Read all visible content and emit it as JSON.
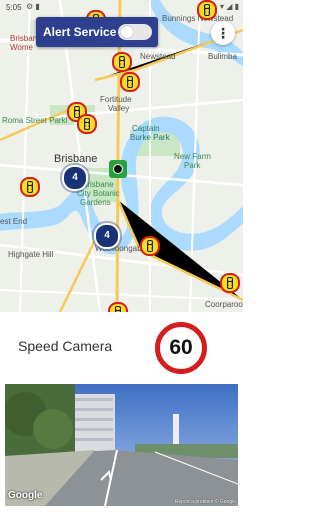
{
  "status_bar": {
    "time": "5:05",
    "left_icons": "⚙ ▮",
    "right_icons": "▾ ◢ ▮"
  },
  "alert_service": {
    "label": "Alert Service",
    "enabled": false
  },
  "menu_icon": "more-vert-icon",
  "map": {
    "labels": {
      "bunnings": "Bunnings Newstead",
      "newstead": "Newstead",
      "bulimba": "Bulimba",
      "fortitude": "Fortitude",
      "valley": "Valley",
      "roma": "Roma Street Parkl",
      "captain": "Captain",
      "burke": "Burke Park",
      "brisbane": "Brisbane",
      "new_farm": "New Farm",
      "park": "Park",
      "bot_1": "Brisbane",
      "bot_2": "City Botanic",
      "bot_3": "Gardens",
      "west_end": "est End",
      "highgate": "Highgate Hill",
      "woolloongabba": "Woolloongabba",
      "coorparoo": "Coorparoo",
      "women_1": "Brisbane",
      "women_2": "Wome"
    },
    "clusters": [
      {
        "count": "4"
      },
      {
        "count": "4"
      }
    ]
  },
  "camera": {
    "type": "Speed Camera",
    "speed_limit": "60"
  },
  "street_view": {
    "google": "Google",
    "report": "Report a problem  © Google"
  },
  "colors": {
    "header": "#2e3f8f",
    "cluster": "#1a3378",
    "sign_border": "#d41d1d",
    "camera_fill": "#f7dd23"
  }
}
